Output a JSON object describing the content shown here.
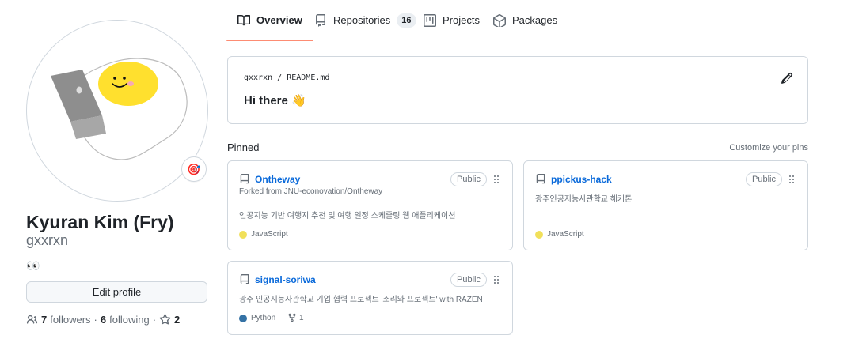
{
  "tabs": [
    {
      "label": "Overview",
      "icon": "book-icon",
      "selected": true
    },
    {
      "label": "Repositories",
      "icon": "repo-icon",
      "count": "16"
    },
    {
      "label": "Projects",
      "icon": "project-icon"
    },
    {
      "label": "Packages",
      "icon": "package-icon"
    }
  ],
  "profile": {
    "full_name": "Kyuran Kim (Fry)",
    "username": "gxxrxn",
    "bio": "👀",
    "edit_label": "Edit profile",
    "followers_count": "7",
    "followers_label": "followers",
    "following_count": "6",
    "following_label": "following",
    "stars_count": "2",
    "dot_sep": "·",
    "status_emoji": "🎯"
  },
  "readme": {
    "owner": "gxxrxn",
    "slash": "/",
    "file": "README.md",
    "title": "Hi there 👋"
  },
  "pinned": {
    "heading": "Pinned",
    "customize": "Customize your pins",
    "cards": [
      {
        "name": "Ontheway",
        "visibility": "Public",
        "forked_from": "Forked from JNU-econovation/Ontheway",
        "description": "인공지능 기반 여행지 추천 및 여행 일정 스케줄링 웹 애플리케이션",
        "language": "JavaScript",
        "language_color": "#f1e05a"
      },
      {
        "name": "ppickus-hack",
        "visibility": "Public",
        "description": "광주인공지능사관학교 해커톤",
        "language": "JavaScript",
        "language_color": "#f1e05a"
      },
      {
        "name": "signal-soriwa",
        "visibility": "Public",
        "description": "광주 인공지능사관학교 기업 협력 프로젝트 '소리와 프로젝트' with RAZEN",
        "language": "Python",
        "language_color": "#3572A5",
        "forks": "1"
      }
    ]
  },
  "colors": {
    "accent_underline": "#fd8c73",
    "link": "#0969da",
    "border": "#d0d7de",
    "muted": "#656d76"
  }
}
